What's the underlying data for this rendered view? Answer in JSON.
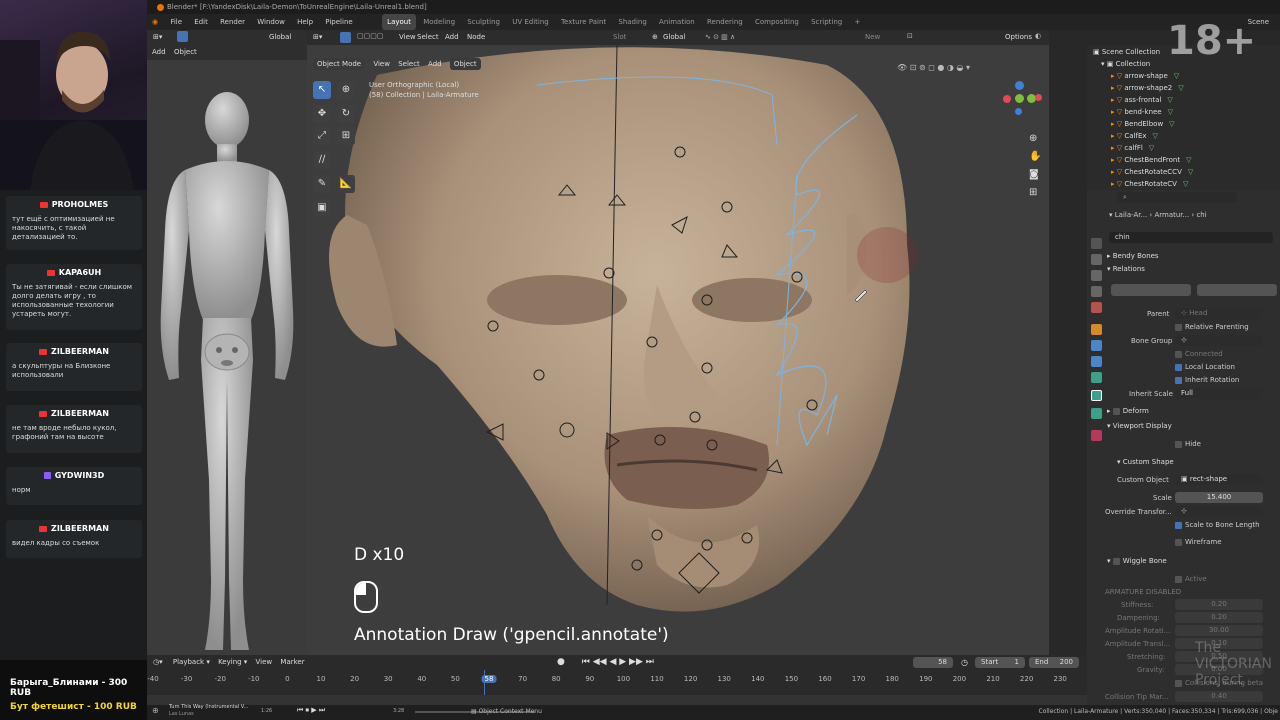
{
  "badge": "18+",
  "chat": [
    {
      "user": "PROHOLMES",
      "platform": "youtube",
      "text": "тут ещё с оптимизацией не накосячить, с такой детализацией то."
    },
    {
      "user": "KAPA6UH",
      "platform": "youtube",
      "text": "Ты не затягивай - если слишком долго делать игру , то использованные техологии устареть могут."
    },
    {
      "user": "ZILBEERMAN",
      "platform": "youtube",
      "text": "а скульптуры на Близконе использовали"
    },
    {
      "user": "ZILBEERMAN",
      "platform": "youtube",
      "text": "не там вроде небыло кукол, графоний там на высоте"
    },
    {
      "user": "GYDWIN3D",
      "platform": "twitch",
      "text": "норм"
    },
    {
      "user": "ZILBEERMAN",
      "platform": "youtube",
      "text": "видел кадры со съемок"
    }
  ],
  "donations": [
    "Барыга_Блинами - 300 RUB",
    "Бут фетешист - 100 RUB"
  ],
  "window_title": "Blender* [F:\\YandexDisk\\Laila-Demon\\ToUnrealEngine\\Laila-Unreal1.blend]",
  "menu": [
    "File",
    "Edit",
    "Render",
    "Window",
    "Help",
    "Pipeline"
  ],
  "workspaces": [
    "Layout",
    "Modeling",
    "Sculpting",
    "UV Editing",
    "Texture Paint",
    "Shading",
    "Animation",
    "Rendering",
    "Compositing",
    "Scripting",
    "+"
  ],
  "scene_label": "Scene",
  "left_header": {
    "add": "Add",
    "object": "Object",
    "global": "Global"
  },
  "vp_header": {
    "orientation": "Global",
    "mode_object": "Object",
    "view": "View",
    "select": "Select",
    "add": "Add",
    "node": "Node",
    "slot": "Slot",
    "new": "New",
    "options": "Options"
  },
  "vp_header2": {
    "mode": "Object Mode",
    "view": "View",
    "select": "Select",
    "add": "Add",
    "object": "Object"
  },
  "viewport": {
    "view_name": "User Orthographic (Local)",
    "collection": "(58) Collection | Laila-Armature",
    "key_text": "D x10",
    "operator": "Annotation Draw ('gpencil.annotate')"
  },
  "outliner": {
    "title": "Scene Collection",
    "collection": "Collection",
    "items": [
      "arrow-shape",
      "arrow-shape2",
      "ass-frontal",
      "bend-knee",
      "BendElbow",
      "CalfEx",
      "calfFl",
      "ChestBendFront",
      "ChestRotateCCV",
      "ChestRotateCV"
    ]
  },
  "props": {
    "crumbs": [
      "Laila-Ar...",
      "Armatur...",
      "chi"
    ],
    "bone_name": "chin",
    "sections": {
      "bendy": "Bendy Bones",
      "relations": "Relations",
      "deform": "Deform",
      "viewport_display": "Viewport Display",
      "custom_shape": "Custom Shape",
      "wiggle": "Wiggle Bone"
    },
    "relations": {
      "parent_label": "Parent",
      "parent_value": "Head",
      "relative_parenting": "Relative Parenting",
      "bone_group": "Bone Group",
      "connected": "Connected",
      "local_location": "Local Location",
      "inherit_rotation": "Inherit Rotation",
      "inherit_scale_label": "Inherit Scale",
      "inherit_scale_value": "Full"
    },
    "display": {
      "hide": "Hide",
      "custom_object_label": "Custom Object",
      "custom_object_value": "rect-shape",
      "scale_label": "Scale",
      "scale_value": "15.400",
      "override_label": "Override Transfor...",
      "scale_to_bone": "Scale to Bone Length",
      "wireframe": "Wireframe"
    },
    "wiggle": {
      "active": "Active",
      "disabled": "ARMATURE DISABLED",
      "stiffness_label": "Stiffness:",
      "stiffness": "0.20",
      "dampening_label": "Dampening:",
      "dampening": "0.20",
      "amp_rot_label": "Amplitude Rotati...",
      "amp_rot": "30.00",
      "amp_trans_label": "Amplitude Transl...",
      "amp_trans": "0.10",
      "stretch_label": "Stretching:",
      "stretch": "0.50",
      "gravity_label": "Gravity:",
      "gravity": "0.00",
      "collisions": "Collisions, during beta",
      "tip_label": "Collision Tip Mar...",
      "tip": "0.40"
    }
  },
  "timeline": {
    "playback": "Playback",
    "keying": "Keying",
    "view": "View",
    "marker": "Marker",
    "current": "58",
    "start_label": "Start",
    "start": "1",
    "end_label": "End",
    "end": "200",
    "ticks": [
      "-40",
      "-30",
      "-20",
      "-10",
      "0",
      "10",
      "20",
      "30",
      "40",
      "50",
      "58",
      "70",
      "80",
      "90",
      "100",
      "110",
      "120",
      "130",
      "140",
      "150",
      "160",
      "170",
      "180",
      "190",
      "200",
      "210",
      "220",
      "230"
    ]
  },
  "status": {
    "music": "Turn This Way (Instrumental V...",
    "artist": "Las Lunas",
    "t1": "1:26",
    "t2": "3:28",
    "context": "Object Context Menu",
    "stats": "Collection | Laila-Armature | Verts:350,040 | Faces:350,334 | Tris:699,036 | Obje"
  },
  "watermark": "The VICTORIAN Project"
}
